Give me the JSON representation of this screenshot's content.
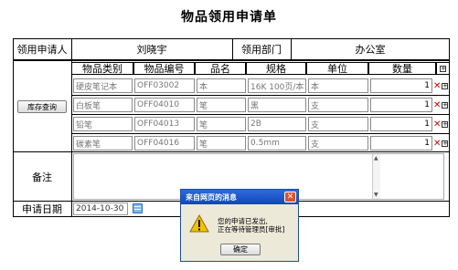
{
  "page": {
    "title": "物品领用申请单"
  },
  "form": {
    "applicant_label": "领用申请人",
    "applicant_value": "刘晓宇",
    "department_label": "领用部门",
    "department_value": "办公室",
    "stock_button": "库存查询",
    "remarks_label": "备注",
    "date_label": "申请日期",
    "date_value": "2014-10-30"
  },
  "items_table": {
    "headers": [
      "物品类别",
      "物品编号",
      "品名",
      "规格",
      "单位",
      "数量"
    ],
    "rows": [
      {
        "category": "硬皮笔记本",
        "code": "OFF03002",
        "name": "本",
        "spec": "16K 100页/本",
        "unit": "本",
        "qty": "1"
      },
      {
        "category": "白板笔",
        "code": "OFF04010",
        "name": "笔",
        "spec": "黑",
        "unit": "支",
        "qty": "1"
      },
      {
        "category": "铅笔",
        "code": "OFF04013",
        "name": "笔",
        "spec": "2B",
        "unit": "支",
        "qty": "1"
      },
      {
        "category": "碳素笔",
        "code": "OFF04016",
        "name": "笔",
        "spec": "0.5mm",
        "unit": "支",
        "qty": "1"
      }
    ]
  },
  "dialog": {
    "title": "来自网页的消息",
    "line1": "您的申请已发出,",
    "line2": "正在等待管理员[审批]",
    "ok": "确定"
  },
  "icons": {
    "add_row": "plus-square-icon",
    "delete_row": "red-x-icon",
    "calendar": "calendar-icon",
    "warning": "warning-triangle-icon",
    "close": "close-icon"
  },
  "colors": {
    "dialog_title": "#1047b8",
    "delete": "#d00000",
    "warning": "#f2c200"
  }
}
